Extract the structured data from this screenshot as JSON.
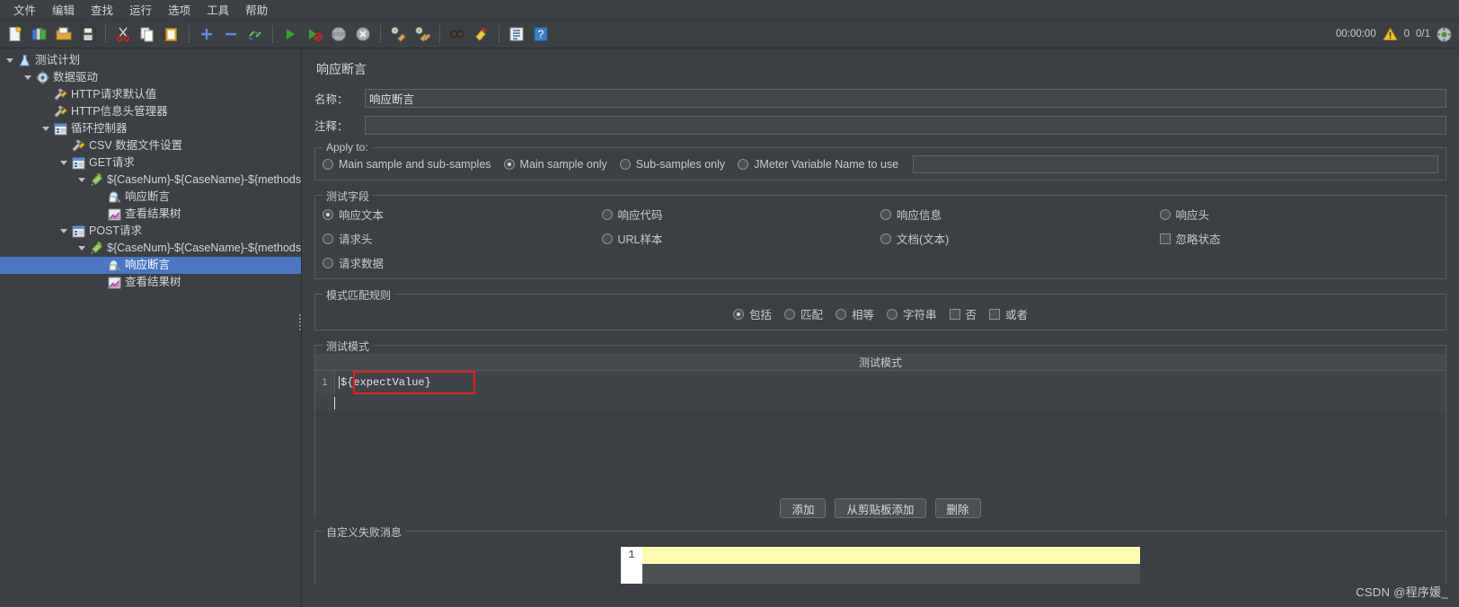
{
  "menubar": {
    "items": [
      {
        "label": "文件",
        "name": "menu-file"
      },
      {
        "label": "编辑",
        "name": "menu-edit"
      },
      {
        "label": "查找",
        "name": "menu-search"
      },
      {
        "label": "运行",
        "name": "menu-run"
      },
      {
        "label": "选项",
        "name": "menu-options"
      },
      {
        "label": "工具",
        "name": "menu-tools"
      },
      {
        "label": "帮助",
        "name": "menu-help"
      }
    ]
  },
  "toolbar": {
    "icons": [
      "new-icon",
      "templates-icon",
      "open-icon",
      "save-icon",
      "sep",
      "cut-icon",
      "copy-icon",
      "paste-icon",
      "sep",
      "add-icon",
      "remove-icon",
      "toggle-icon",
      "sep",
      "start-icon",
      "start-no-timers-icon",
      "stop-icon",
      "shutdown-icon",
      "sep",
      "clear-icon",
      "clear-all-icon",
      "sep",
      "search-icon",
      "reset-search-icon",
      "sep",
      "function-helper-icon",
      "help-icon"
    ],
    "status": {
      "elapsed": "00:00:00",
      "warning_icon": "warning-triangle-icon",
      "warning_count": "0",
      "threads": "0/1",
      "target_icon": "thread-target-icon"
    }
  },
  "tree": {
    "nodes": [
      {
        "label": "测试计划",
        "icon": "test-plan-icon",
        "indent": 0,
        "expanded": true,
        "selected": false,
        "name": "tree-node-test-plan"
      },
      {
        "label": "数据驱动",
        "icon": "thread-group-icon",
        "indent": 1,
        "expanded": true,
        "selected": false,
        "name": "tree-node-thread-group"
      },
      {
        "label": "HTTP请求默认值",
        "icon": "config-icon",
        "indent": 2,
        "expanded": null,
        "selected": false,
        "name": "tree-node-http-defaults"
      },
      {
        "label": "HTTP信息头管理器",
        "icon": "config-icon",
        "indent": 2,
        "expanded": null,
        "selected": false,
        "name": "tree-node-header-manager"
      },
      {
        "label": "循环控制器",
        "icon": "controller-icon",
        "indent": 2,
        "expanded": true,
        "selected": false,
        "name": "tree-node-loop-controller"
      },
      {
        "label": "CSV 数据文件设置",
        "icon": "config-icon",
        "indent": 3,
        "expanded": null,
        "selected": false,
        "name": "tree-node-csv-data-set"
      },
      {
        "label": "GET请求",
        "icon": "controller-icon",
        "indent": 3,
        "expanded": true,
        "selected": false,
        "name": "tree-node-get-request"
      },
      {
        "label": "${CaseNum}-${CaseName}-${methods}",
        "icon": "sampler-icon",
        "indent": 4,
        "expanded": true,
        "selected": false,
        "name": "tree-node-get-sampler"
      },
      {
        "label": "响应断言",
        "icon": "assertion-icon",
        "indent": 5,
        "expanded": null,
        "selected": false,
        "name": "tree-node-get-assertion"
      },
      {
        "label": "查看结果树",
        "icon": "listener-icon",
        "indent": 5,
        "expanded": null,
        "selected": false,
        "name": "tree-node-get-results-tree"
      },
      {
        "label": "POST请求",
        "icon": "controller-icon",
        "indent": 3,
        "expanded": true,
        "selected": false,
        "name": "tree-node-post-request"
      },
      {
        "label": "${CaseNum}-${CaseName}-${methods}",
        "icon": "sampler-icon",
        "indent": 4,
        "expanded": true,
        "selected": false,
        "name": "tree-node-post-sampler"
      },
      {
        "label": "响应断言",
        "icon": "assertion-icon",
        "indent": 5,
        "expanded": null,
        "selected": true,
        "name": "tree-node-post-assertion"
      },
      {
        "label": "查看结果树",
        "icon": "listener-icon",
        "indent": 5,
        "expanded": null,
        "selected": false,
        "name": "tree-node-post-results-tree"
      }
    ]
  },
  "panel": {
    "title": "响应断言",
    "name_label": "名称：",
    "name_value": "响应断言",
    "comment_label": "注释：",
    "comment_value": "",
    "apply_to": {
      "title": "Apply to:",
      "options": [
        {
          "label": "Main sample and sub-samples",
          "selected": false,
          "name": "radio-main-and-sub"
        },
        {
          "label": "Main sample only",
          "selected": true,
          "name": "radio-main-only"
        },
        {
          "label": "Sub-samples only",
          "selected": false,
          "name": "radio-sub-only"
        },
        {
          "label": "JMeter Variable Name to use",
          "selected": false,
          "name": "radio-jmeter-variable"
        }
      ],
      "variable_value": ""
    },
    "test_field": {
      "title": "测试字段",
      "options": [
        {
          "label": "响应文本",
          "type": "radio",
          "selected": true,
          "name": "radio-response-text"
        },
        {
          "label": "响应代码",
          "type": "radio",
          "selected": false,
          "name": "radio-response-code"
        },
        {
          "label": "响应信息",
          "type": "radio",
          "selected": false,
          "name": "radio-response-message"
        },
        {
          "label": "响应头",
          "type": "radio",
          "selected": false,
          "name": "radio-response-headers"
        },
        {
          "label": "请求头",
          "type": "radio",
          "selected": false,
          "name": "radio-request-headers"
        },
        {
          "label": "URL样本",
          "type": "radio",
          "selected": false,
          "name": "radio-url-sampled"
        },
        {
          "label": "文档(文本)",
          "type": "radio",
          "selected": false,
          "name": "radio-document-text"
        },
        {
          "label": "忽略状态",
          "type": "check",
          "selected": false,
          "name": "checkbox-ignore-status"
        },
        {
          "label": "请求数据",
          "type": "radio",
          "selected": false,
          "name": "radio-request-data"
        }
      ]
    },
    "pattern_rules": {
      "title": "模式匹配规则",
      "options": [
        {
          "label": "包括",
          "type": "radio",
          "selected": true,
          "name": "radio-contains"
        },
        {
          "label": "匹配",
          "type": "radio",
          "selected": false,
          "name": "radio-matches"
        },
        {
          "label": "相等",
          "type": "radio",
          "selected": false,
          "name": "radio-equals"
        },
        {
          "label": "字符串",
          "type": "radio",
          "selected": false,
          "name": "radio-substring"
        },
        {
          "label": "否",
          "type": "check",
          "selected": false,
          "name": "checkbox-not"
        },
        {
          "label": "或者",
          "type": "check",
          "selected": false,
          "name": "checkbox-or"
        }
      ]
    },
    "test_patterns": {
      "title": "测试模式",
      "column_header": "测试模式",
      "rows": [
        {
          "index": "1",
          "value": "${expectValue}",
          "highlighted": true
        }
      ]
    },
    "buttons": [
      {
        "label": "添加",
        "name": "add-pattern-button"
      },
      {
        "label": "从剪贴板添加",
        "name": "add-from-clipboard-button"
      },
      {
        "label": "删除",
        "name": "delete-pattern-button"
      }
    ],
    "failure_message": {
      "title": "自定义失败消息",
      "line_number": "1",
      "value": ""
    }
  },
  "watermark": "CSDN @程序媛_",
  "colors": {
    "background": "#3c4043",
    "selection": "#4a76c4",
    "highlight_box": "#e02020",
    "editor_highlight": "#fdfbb0"
  }
}
